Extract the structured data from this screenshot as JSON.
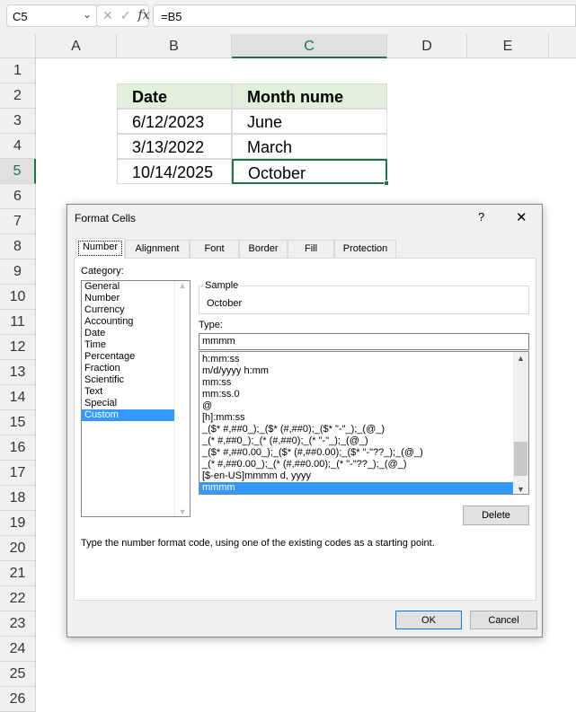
{
  "formula_bar": {
    "name_box": "C5",
    "formula": "=B5",
    "fx_label": "fx",
    "cancel_glyph": "✕",
    "enter_glyph": "✓"
  },
  "columns": [
    "A",
    "B",
    "C",
    "D",
    "E"
  ],
  "rows": [
    "1",
    "2",
    "3",
    "4",
    "5",
    "6",
    "7",
    "8",
    "9",
    "10",
    "11",
    "12",
    "13",
    "14",
    "15",
    "16",
    "17",
    "18",
    "19",
    "20",
    "21",
    "22",
    "23",
    "24",
    "25",
    "26"
  ],
  "selected_cell": "C5",
  "table": {
    "headers": [
      "Date",
      "Month nume"
    ],
    "rows": [
      [
        "6/12/2023",
        "June"
      ],
      [
        "3/13/2022",
        "March"
      ],
      [
        "10/14/2025",
        "October"
      ]
    ]
  },
  "colors": {
    "accent": "#217346",
    "header_fill": "#e2efda",
    "selection": "#3399ff"
  },
  "dialog": {
    "title": "Format Cells",
    "help": "?",
    "close": "✕",
    "tabs": [
      "Number",
      "Alignment",
      "Font",
      "Border",
      "Fill",
      "Protection"
    ],
    "active_tab": "Number",
    "category_label": "Category:",
    "categories": [
      "General",
      "Number",
      "Currency",
      "Accounting",
      "Date",
      "Time",
      "Percentage",
      "Fraction",
      "Scientific",
      "Text",
      "Special",
      "Custom"
    ],
    "selected_category": "Custom",
    "sample_label": "Sample",
    "sample_value": "October",
    "type_label": "Type:",
    "type_value": "mmmm",
    "formats": [
      "h:mm:ss",
      "m/d/yyyy h:mm",
      "mm:ss",
      "mm:ss.0",
      "@",
      "[h]:mm:ss",
      "_($* #,##0_);_($* (#,##0);_($* \"-\"_);_(@_)",
      "_(* #,##0_);_(* (#,##0);_(* \"-\"_);_(@_)",
      "_($* #,##0.00_);_($* (#,##0.00);_($* \"-\"??_);_(@_)",
      "_(* #,##0.00_);_(* (#,##0.00);_(* \"-\"??_);_(@_)",
      "[$-en-US]mmmm d, yyyy",
      "mmmm"
    ],
    "selected_format": "mmmm",
    "delete_label": "Delete",
    "description": "Type the number format code, using one of the existing codes as a starting point.",
    "ok_label": "OK",
    "cancel_label": "Cancel"
  }
}
